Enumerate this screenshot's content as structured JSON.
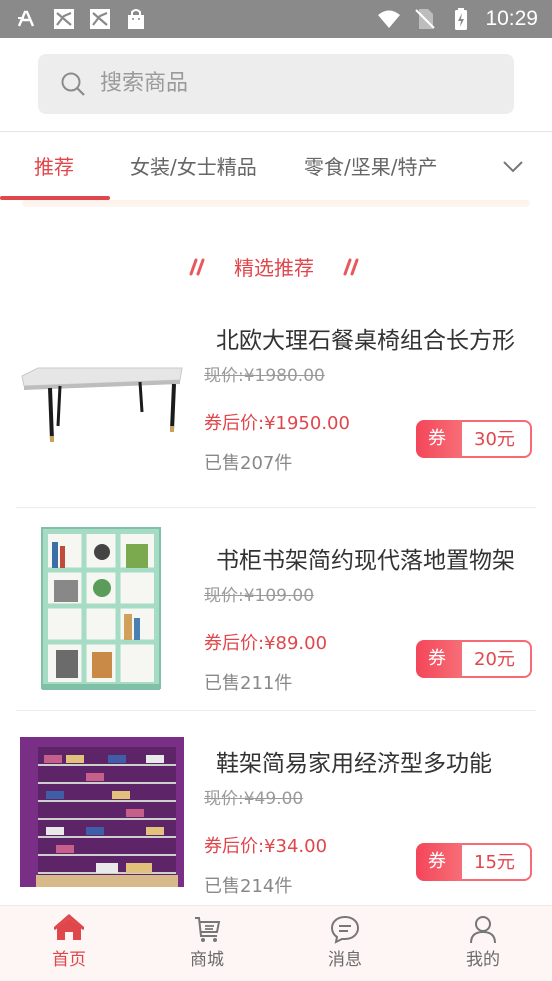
{
  "status_bar": {
    "time": "10:29",
    "icons": [
      "font-icon",
      "image-icon",
      "image-icon",
      "shopping-bag-icon",
      "wifi-icon",
      "no-sim-icon",
      "battery-charging-icon"
    ]
  },
  "search": {
    "placeholder": "搜索商品",
    "icon": "search-icon"
  },
  "tabs": {
    "items": [
      {
        "label": "推荐",
        "active": true
      },
      {
        "label": "女装/女士精品",
        "active": false
      },
      {
        "label": "零食/坚果/特产",
        "active": false
      }
    ],
    "expand_icon": "chevron-down-icon"
  },
  "section": {
    "title": "精选推荐"
  },
  "products": [
    {
      "name": "北欧大理石餐桌椅组合长方形",
      "original_price": "现价:¥1980.00",
      "after_coupon_price": "券后价:¥1950.00",
      "sold": "已售207件",
      "coupon_tag": "券",
      "coupon_value": "30元",
      "image": "marble-table-image"
    },
    {
      "name": "书柜书架简约现代落地置物架",
      "original_price": "现价:¥109.00",
      "after_coupon_price": "券后价:¥89.00",
      "sold": "已售211件",
      "coupon_tag": "券",
      "coupon_value": "20元",
      "image": "bookshelf-image"
    },
    {
      "name": "鞋架简易家用经济型多功能",
      "original_price": "现价:¥49.00",
      "after_coupon_price": "券后价:¥34.00",
      "sold": "已售214件",
      "coupon_tag": "券",
      "coupon_value": "15元",
      "image": "shoe-rack-image"
    }
  ],
  "bottom_nav": [
    {
      "label": "首页",
      "icon": "home-icon",
      "active": true
    },
    {
      "label": "商城",
      "icon": "cart-icon",
      "active": false
    },
    {
      "label": "消息",
      "icon": "message-icon",
      "active": false
    },
    {
      "label": "我的",
      "icon": "user-icon",
      "active": false
    }
  ],
  "colors": {
    "accent": "#e0474c",
    "status_bar": "#8a8a8a",
    "nav_bg": "#fdf6f4"
  }
}
